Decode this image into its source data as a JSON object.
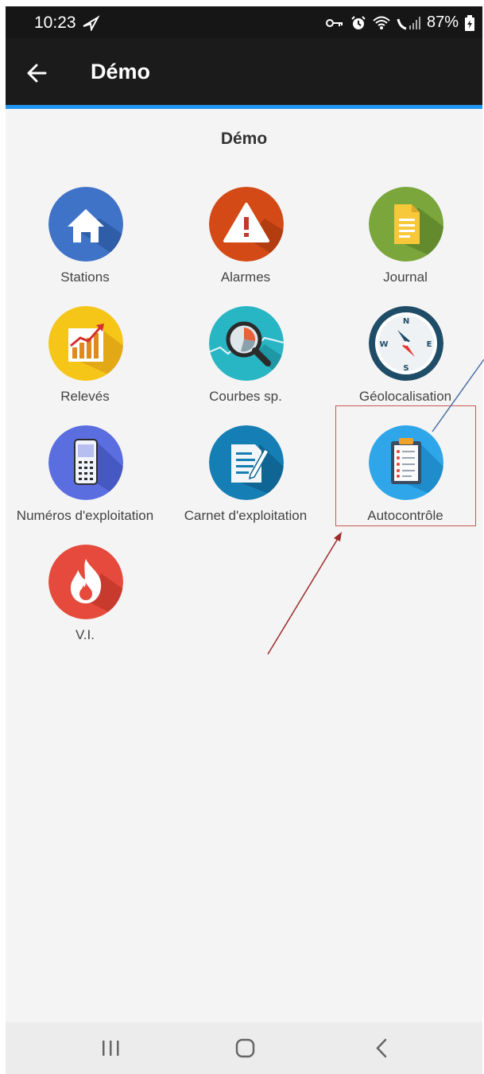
{
  "status_bar": {
    "time": "10:23",
    "battery": "87%"
  },
  "app_bar": {
    "title": "Démo"
  },
  "section": {
    "title": "Démo"
  },
  "tiles": [
    {
      "label": "Stations",
      "icon": "house-icon",
      "color": "#3f73c7"
    },
    {
      "label": "Alarmes",
      "icon": "warning-icon",
      "color": "#d34a17"
    },
    {
      "label": "Journal",
      "icon": "document-icon",
      "color": "#7aa63c"
    },
    {
      "label": "Relevés",
      "icon": "bar-chart-icon",
      "color": "#f5c518"
    },
    {
      "label": "Courbes sp.",
      "icon": "magnifier-chart-icon",
      "color": "#29b6c4"
    },
    {
      "label": "Géolocalisation",
      "icon": "compass-icon",
      "color": "#1f4d67"
    },
    {
      "label": "Numéros d'exploitation",
      "icon": "mobile-phone-icon",
      "color": "#5b6ee0"
    },
    {
      "label": "Carnet d'exploitation",
      "icon": "notebook-icon",
      "color": "#157fb5"
    },
    {
      "label": "Autocontrôle",
      "icon": "clipboard-icon",
      "color": "#2fa6ea"
    },
    {
      "label": "V.I.",
      "icon": "fire-icon",
      "color": "#e64a3c"
    }
  ],
  "colors": {
    "accent": "#2196f3",
    "app_bar": "#1b1b1b",
    "highlight": "#c9574f"
  }
}
